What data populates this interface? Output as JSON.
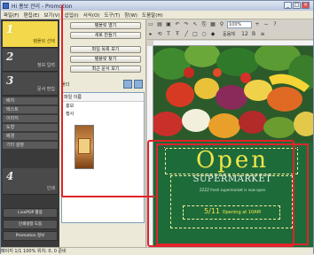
{
  "window": {
    "title": "Hi 홍보 관리 - Promotion",
    "controls": [
      "_",
      "□",
      "×"
    ]
  },
  "menu": [
    "파일(F)",
    "편집(E)",
    "보기(V)",
    "삽입(I)",
    "서식(O)",
    "도구(T)",
    "창(W)",
    "도움말(H)"
  ],
  "steps": [
    {
      "num": "1",
      "label": "템플릿 선택",
      "active": true
    },
    {
      "num": "2",
      "label": "정보 입력"
    },
    {
      "num": "3",
      "label": "문서 편집"
    },
    {
      "num": "4",
      "label": "인쇄"
    }
  ],
  "step3_items": [
    "배치",
    "텍스트",
    "이미지",
    "도형",
    "배경",
    "기타 설정"
  ],
  "bottom_buttons": [
    "LivePOP 활용",
    "인쇄설정 도움",
    "Promotion 정보"
  ],
  "mid_buttons": [
    "템플릿 열기",
    "새로 만들기",
    "파일 목록 보기",
    "템플릿 찾기",
    "최근 문서 보기",
    "새 작업 시작"
  ],
  "project": {
    "label": "폴더",
    "list_header": "파일 이름",
    "rows": [
      "홍보",
      "행사"
    ]
  },
  "toolbar": {
    "zoom": "100%",
    "font_label": "돋움체",
    "size_label": "12"
  },
  "poster": {
    "headline": "Open",
    "subhead": "SUPERMARKET",
    "tagline": "ZZZZ fresh supermarket is now open",
    "date": "5/11",
    "date_suffix": "Opening at 10AM"
  },
  "status": "페이지 1/1   100%   위치: 0, 0   준비"
}
